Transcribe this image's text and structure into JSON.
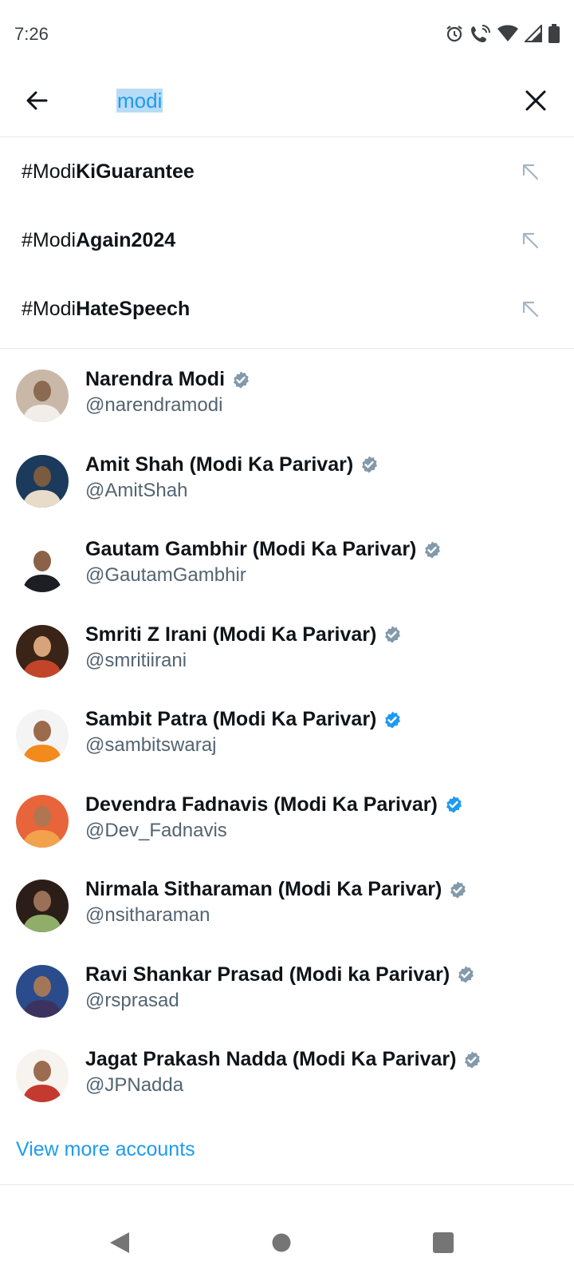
{
  "status": {
    "time": "7:26",
    "icons": [
      "alarm-icon",
      "wifi-calling-icon",
      "wifi-icon",
      "signal-icon",
      "battery-icon"
    ]
  },
  "search": {
    "query": "modi"
  },
  "suggestions": [
    {
      "prefix": "#Modi",
      "rest": "KiGuarantee"
    },
    {
      "prefix": "#Modi",
      "rest": "Again2024"
    },
    {
      "prefix": "#Modi",
      "rest": "HateSpeech"
    }
  ],
  "accounts": [
    {
      "name": "Narendra Modi",
      "handle": "@narendramodi",
      "verified": "gray",
      "avatar_colors": [
        "#c9b8a8",
        "#f1eee9",
        "#8a6a50"
      ]
    },
    {
      "name": "Amit Shah (Modi Ka Parivar)",
      "handle": "@AmitShah",
      "verified": "gray",
      "avatar_colors": [
        "#1b3a5c",
        "#e8dcc8",
        "#7a5b3f"
      ]
    },
    {
      "name": "Gautam Gambhir (Modi Ka Parivar)",
      "handle": "@GautamGambhir",
      "verified": "gray",
      "avatar_colors": [
        "#ffffff",
        "#1c1e24",
        "#8b6246"
      ]
    },
    {
      "name": "Smriti Z Irani (Modi Ka Parivar)",
      "handle": "@smritiirani",
      "verified": "gray",
      "avatar_colors": [
        "#3a2417",
        "#c2452a",
        "#d7a37a"
      ]
    },
    {
      "name": "Sambit Patra (Modi Ka Parivar)",
      "handle": "@sambitswaraj",
      "verified": "blue",
      "avatar_colors": [
        "#f4f4f4",
        "#f28a1c",
        "#9b6b4b"
      ]
    },
    {
      "name": "Devendra Fadnavis (Modi Ka Parivar)",
      "handle": "@Dev_Fadnavis",
      "verified": "blue",
      "avatar_colors": [
        "#e8643a",
        "#f2a24a",
        "#b07652"
      ]
    },
    {
      "name": "Nirmala Sitharaman (Modi Ka Parivar)",
      "handle": "@nsitharaman",
      "verified": "gray",
      "avatar_colors": [
        "#2b1d18",
        "#8fae6a",
        "#9a7056"
      ]
    },
    {
      "name": "Ravi Shankar Prasad (Modi ka Parivar)",
      "handle": "@rsprasad",
      "verified": "gray",
      "avatar_colors": [
        "#2a4c8c",
        "#3c3260",
        "#a3765a"
      ]
    },
    {
      "name": "Jagat Prakash Nadda (Modi Ka Parivar)",
      "handle": "@JPNadda",
      "verified": "gray",
      "avatar_colors": [
        "#f7f3ee",
        "#c43a2e",
        "#9c6c50"
      ]
    }
  ],
  "view_more": "View more accounts",
  "colors": {
    "accent": "#1d9bf0",
    "verified_gray": "#829aab",
    "verified_blue": "#1d9bf0",
    "text_primary": "#0f1419",
    "text_secondary": "#536471"
  },
  "nav": [
    "back-nav-icon",
    "home-nav-icon",
    "recents-nav-icon"
  ]
}
